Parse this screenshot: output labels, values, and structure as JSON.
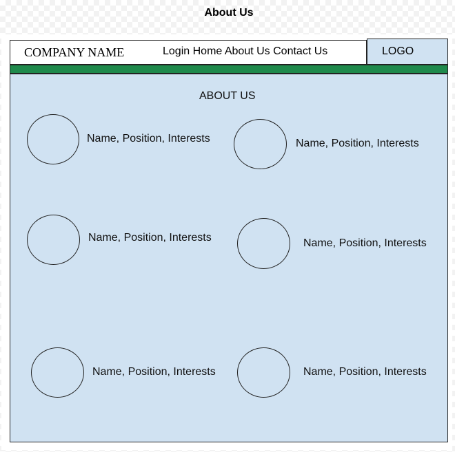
{
  "page_title": "About Us",
  "header": {
    "company_name": "COMPANY NAME",
    "nav": [
      "Login",
      "Home",
      "About Us",
      "Contact Us"
    ],
    "logo": "LOGO"
  },
  "main": {
    "section_title": "ABOUT US",
    "members": [
      {
        "text": "Name, Position, Interests"
      },
      {
        "text": "Name, Position, Interests"
      },
      {
        "text": "Name, Position, Interests"
      },
      {
        "text": "Name, Position, Interests"
      },
      {
        "text": "Name, Position, Interests"
      },
      {
        "text": "Name, Position, Interests"
      }
    ]
  },
  "colors": {
    "content_background": "#d0e2f2",
    "accent_bar": "#1f8a4c"
  }
}
